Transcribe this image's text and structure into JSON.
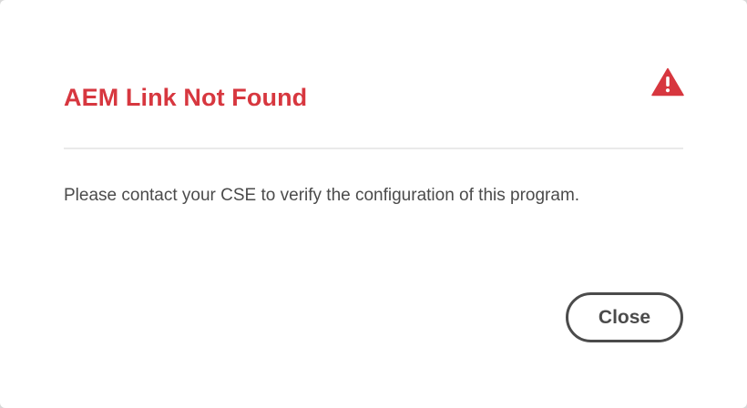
{
  "dialog": {
    "title": "AEM Link Not Found",
    "message": "Please contact your CSE to verify the configuration of this program.",
    "close_label": "Close",
    "icon": "alert-triangle-icon",
    "colors": {
      "title": "#d7373f",
      "icon": "#d7373f",
      "text": "#4b4b4b",
      "divider": "#eaeaea"
    }
  }
}
